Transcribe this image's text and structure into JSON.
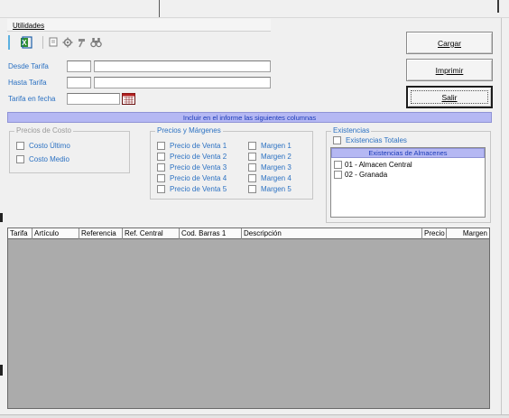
{
  "menu": {
    "title": "Utilidades"
  },
  "buttons": {
    "cargar": "Cargar",
    "imprimir": "Imprimir",
    "salir": "Salir"
  },
  "filters": {
    "desde_label": "Desde Tarifa",
    "hasta_label": "Hasta Tarifa",
    "fecha_label": "Tarifa en fecha"
  },
  "include_banner": "Incluir en el informe las siguientes columnas",
  "costo": {
    "title": "Precios de Costo",
    "items": [
      "Costo Último",
      "Costo Medio"
    ]
  },
  "precios": {
    "title": "Precios y Márgenes",
    "ventas": [
      "Precio de Venta 1",
      "Precio de Venta 2",
      "Precio de Venta 3",
      "Precio de Venta 4",
      "Precio de Venta 5"
    ],
    "margenes": [
      "Margen 1",
      "Margen 2",
      "Margen 3",
      "Margen 4",
      "Margen 5"
    ]
  },
  "existencias": {
    "title": "Existencias",
    "totales": "Existencias Totales",
    "almacenes_header": "Existencias de Almacenes",
    "almacenes": [
      "01 - Almacen Central",
      "02 - Granada"
    ]
  },
  "grid": {
    "columns": [
      "Tarifa",
      "Artículo",
      "Referencia",
      "Ref. Central",
      "Cod. Barras 1",
      "Descripción",
      "Precio",
      "Margen"
    ]
  },
  "icons": [
    "export-excel-icon",
    "preview-icon",
    "gear-icon",
    "hammer-icon",
    "binoculars-icon",
    "calendar-icon"
  ]
}
